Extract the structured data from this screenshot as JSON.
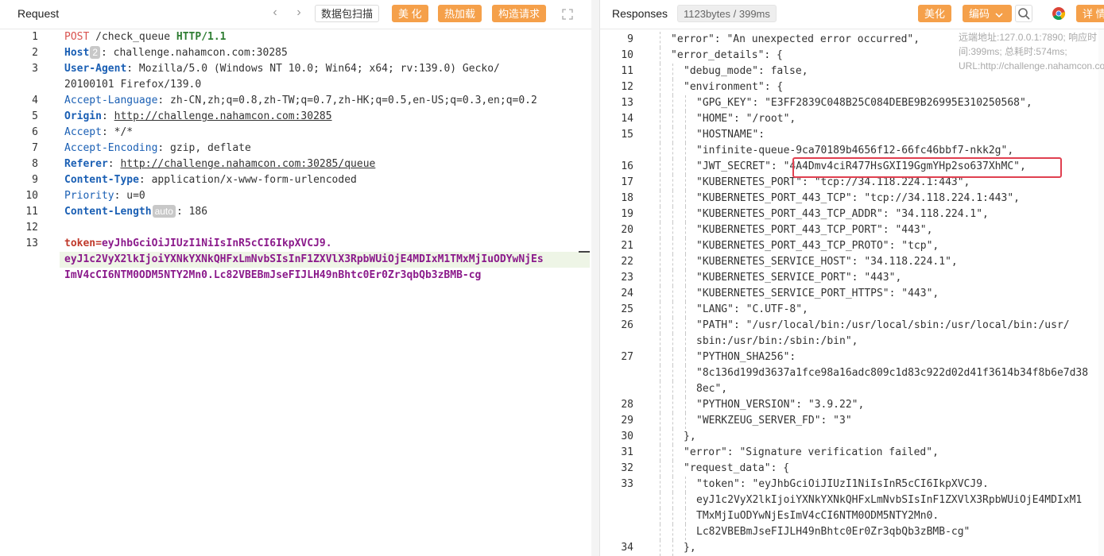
{
  "request": {
    "title": "Request",
    "scan_label": "数据包扫描",
    "beautify_label": "美 化",
    "hotload_label": "热加载",
    "build_label": "构造请求",
    "host_badge": "2",
    "auto_badge": "auto",
    "lines": [
      {
        "n": "1",
        "segs": [
          [
            "k-method",
            "POST"
          ],
          [
            "k-val",
            " /check_queue "
          ],
          [
            "k-proto",
            "HTTP/1.1"
          ]
        ]
      },
      {
        "n": "2",
        "segs": [
          [
            "k-hn",
            "Host"
          ],
          [
            "badge",
            "2"
          ],
          [
            "k-val",
            ": challenge.nahamcon.com:30285"
          ]
        ]
      },
      {
        "n": "3",
        "segs": [
          [
            "k-hn",
            "User-Agent"
          ],
          [
            "k-val",
            ": Mozilla/5.0 (Windows NT 10.0; Win64; x64; rv:139.0) Gecko/"
          ]
        ]
      },
      {
        "n": "",
        "segs": [
          [
            "k-val",
            "20100101 Firefox/139.0"
          ]
        ]
      },
      {
        "n": "4",
        "segs": [
          [
            "k-hr",
            "Accept-Language"
          ],
          [
            "k-val",
            ": zh-CN,zh;q=0.8,zh-TW;q=0.7,zh-HK;q=0.5,en-US;q=0.3,en;q=0.2"
          ]
        ]
      },
      {
        "n": "5",
        "segs": [
          [
            "k-hn",
            "Origin"
          ],
          [
            "k-val",
            ": "
          ],
          [
            "k-url",
            "http://challenge.nahamcon.com:30285"
          ]
        ]
      },
      {
        "n": "6",
        "segs": [
          [
            "k-hr",
            "Accept"
          ],
          [
            "k-val",
            ": */*"
          ]
        ]
      },
      {
        "n": "7",
        "segs": [
          [
            "k-hr",
            "Accept-Encoding"
          ],
          [
            "k-val",
            ": gzip, deflate"
          ]
        ]
      },
      {
        "n": "8",
        "segs": [
          [
            "k-hn",
            "Referer"
          ],
          [
            "k-val",
            ": "
          ],
          [
            "k-url",
            "http://challenge.nahamcon.com:30285/queue"
          ]
        ]
      },
      {
        "n": "9",
        "segs": [
          [
            "k-hn",
            "Content-Type"
          ],
          [
            "k-val",
            ": application/x-www-form-urlencoded"
          ]
        ]
      },
      {
        "n": "10",
        "segs": [
          [
            "k-hr",
            "Priority"
          ],
          [
            "k-val",
            ": u=0"
          ]
        ]
      },
      {
        "n": "11",
        "segs": [
          [
            "k-hn",
            "Content-Length"
          ],
          [
            "badge",
            "auto"
          ],
          [
            "k-val",
            ": 186"
          ]
        ]
      },
      {
        "n": "12",
        "segs": []
      },
      {
        "n": "13",
        "segs": [
          [
            "k-tokeq",
            "token="
          ],
          [
            "k-tok",
            "eyJhbGciOiJIUzI1NiIsInR5cCI6IkpXVCJ9."
          ]
        ]
      },
      {
        "n": "",
        "segs": [
          [
            "k-tok",
            "eyJ1c2VyX2lkIjoiYXNkYXNkQHFxLmNvbSIsInF1ZXVlX3RpbWUiOjE4MDIxM1TMxMjIuODYwNjEs"
          ]
        ]
      },
      {
        "n": "",
        "segs": [
          [
            "k-tok",
            "ImV4cCI6NTM0ODM5NTY2Mn0.Lc82VBEBmJseFIJLH49nBhtc0Er0Zr3qbQb3zBMB-cg"
          ]
        ]
      }
    ]
  },
  "response": {
    "title": "Responses",
    "size_label": "1123bytes / 399ms",
    "beautify_label": "美化",
    "encoding_label": "编码",
    "details_label": "详 情",
    "remote_info": "远端地址:127.0.0.1:7890; 响应时间:399ms; 总耗时:574ms; URL:http://challenge.nahamcon.com:...",
    "lines": [
      {
        "n": "9",
        "i": 1,
        "t": "\"error\": \"An unexpected error occurred\","
      },
      {
        "n": "10",
        "i": 1,
        "t": "\"error_details\": {"
      },
      {
        "n": "11",
        "i": 2,
        "t": "\"debug_mode\": false,"
      },
      {
        "n": "12",
        "i": 2,
        "t": "\"environment\": {"
      },
      {
        "n": "13",
        "i": 3,
        "t": "\"GPG_KEY\": \"E3FF2839C048B25C084DEBE9B26995E310250568\","
      },
      {
        "n": "14",
        "i": 3,
        "t": "\"HOME\": \"/root\","
      },
      {
        "n": "15",
        "i": 3,
        "t": "\"HOSTNAME\":"
      },
      {
        "n": "",
        "i": 3,
        "t": "\"infinite-queue-9ca70189b4656f12-66fc46bbf7-nkk2g\","
      },
      {
        "n": "16",
        "i": 3,
        "t": "\"JWT_SECRET\": \"4A4Dmv4ciR477HsGXI19GgmYHp2so637XhMC\","
      },
      {
        "n": "17",
        "i": 3,
        "t": "\"KUBERNETES_PORT\": \"tcp://34.118.224.1:443\","
      },
      {
        "n": "18",
        "i": 3,
        "t": "\"KUBERNETES_PORT_443_TCP\": \"tcp://34.118.224.1:443\","
      },
      {
        "n": "19",
        "i": 3,
        "t": "\"KUBERNETES_PORT_443_TCP_ADDR\": \"34.118.224.1\","
      },
      {
        "n": "20",
        "i": 3,
        "t": "\"KUBERNETES_PORT_443_TCP_PORT\": \"443\","
      },
      {
        "n": "21",
        "i": 3,
        "t": "\"KUBERNETES_PORT_443_TCP_PROTO\": \"tcp\","
      },
      {
        "n": "22",
        "i": 3,
        "t": "\"KUBERNETES_SERVICE_HOST\": \"34.118.224.1\","
      },
      {
        "n": "23",
        "i": 3,
        "t": "\"KUBERNETES_SERVICE_PORT\": \"443\","
      },
      {
        "n": "24",
        "i": 3,
        "t": "\"KUBERNETES_SERVICE_PORT_HTTPS\": \"443\","
      },
      {
        "n": "25",
        "i": 3,
        "t": "\"LANG\": \"C.UTF-8\","
      },
      {
        "n": "26",
        "i": 3,
        "t": "\"PATH\": \"/usr/local/bin:/usr/local/sbin:/usr/local/bin:/usr/"
      },
      {
        "n": "",
        "i": 3,
        "t": "sbin:/usr/bin:/sbin:/bin\","
      },
      {
        "n": "27",
        "i": 3,
        "t": "\"PYTHON_SHA256\":"
      },
      {
        "n": "",
        "i": 3,
        "t": "\"8c136d199d3637a1fce98a16adc809c1d83c922d02d41f3614b34f8b6e7d38"
      },
      {
        "n": "",
        "i": 3,
        "t": "8ec\","
      },
      {
        "n": "28",
        "i": 3,
        "t": "\"PYTHON_VERSION\": \"3.9.22\","
      },
      {
        "n": "29",
        "i": 3,
        "t": "\"WERKZEUG_SERVER_FD\": \"3\""
      },
      {
        "n": "30",
        "i": 2,
        "t": "},"
      },
      {
        "n": "31",
        "i": 2,
        "t": "\"error\": \"Signature verification failed\","
      },
      {
        "n": "32",
        "i": 2,
        "t": "\"request_data\": {"
      },
      {
        "n": "33",
        "i": 3,
        "t": "\"token\": \"eyJhbGciOiJIUzI1NiIsInR5cCI6IkpXVCJ9."
      },
      {
        "n": "",
        "i": 3,
        "t": "eyJ1c2VyX2lkIjoiYXNkYXNkQHFxLmNvbSIsInF1ZXVlX3RpbWUiOjE4MDIxM1"
      },
      {
        "n": "",
        "i": 3,
        "t": "TMxMjIuODYwNjEsImV4cCI6NTM0ODM5NTY2Mn0."
      },
      {
        "n": "",
        "i": 3,
        "t": "Lc82VBEBmJseFIJLH49nBhtc0Er0Zr3qbQb3zBMB-cg\""
      },
      {
        "n": "34",
        "i": 2,
        "t": "},"
      }
    ]
  },
  "colors": {
    "accent_orange": "#f5a04a",
    "highlight_box": "#e04050",
    "header_name": "#1a5fb4",
    "method": "#d9534f",
    "token": "#8b1a8b"
  }
}
